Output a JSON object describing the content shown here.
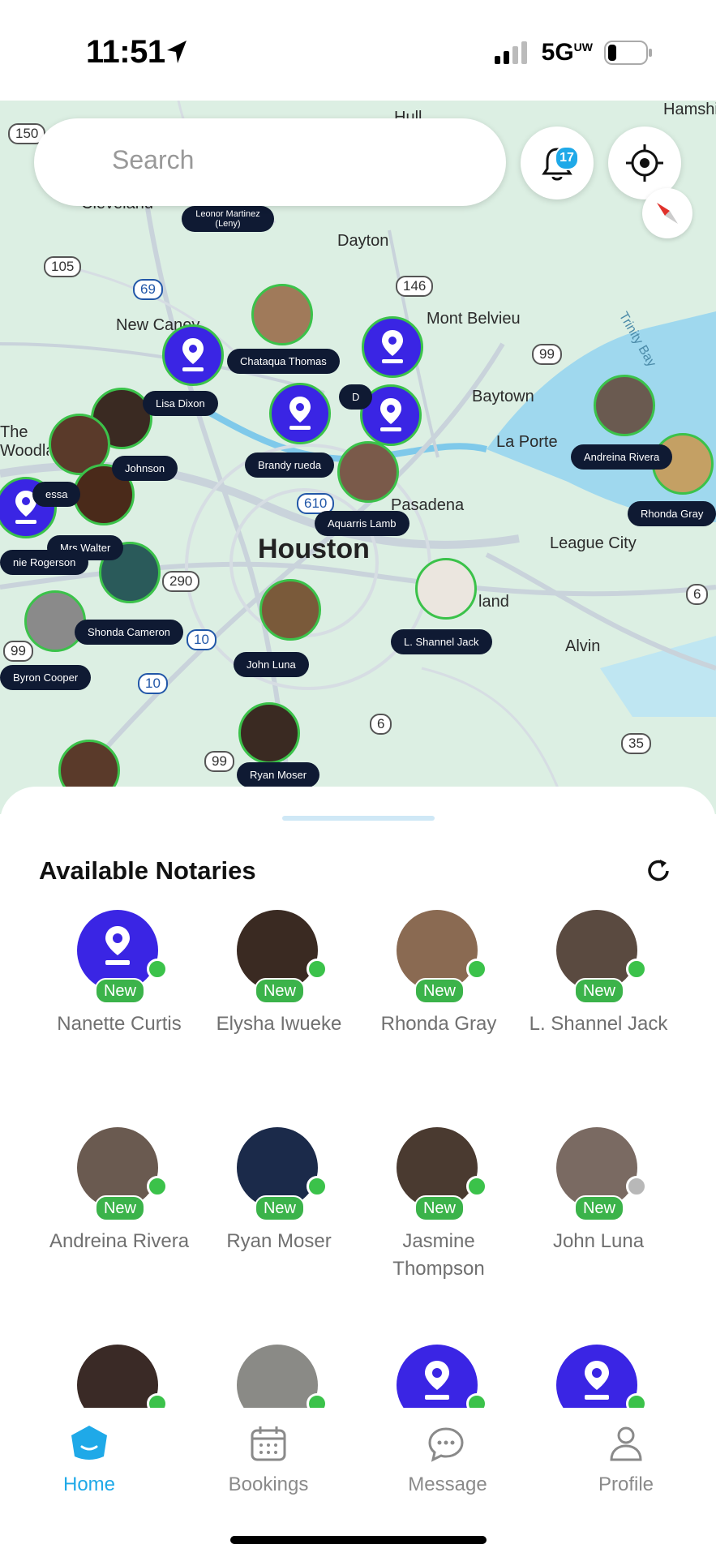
{
  "status_bar": {
    "time": "11:51",
    "network": "5G",
    "network_sup": "UW"
  },
  "search": {
    "placeholder": "Search"
  },
  "notifications": {
    "count": "17"
  },
  "map": {
    "places": [
      {
        "name": "Dayton"
      },
      {
        "name": "New Caney"
      },
      {
        "name": "Mont Belvieu"
      },
      {
        "name": "Baytown"
      },
      {
        "name": "La Porte"
      },
      {
        "name": "Pasadena"
      },
      {
        "name": "Houston"
      },
      {
        "name": "League City"
      },
      {
        "name": "Alvin"
      },
      {
        "name": "The Woodlands"
      },
      {
        "name": "Cleveland"
      },
      {
        "name": "Trinity Bay"
      },
      {
        "name": "land"
      },
      {
        "name": "Hull"
      },
      {
        "name": "Hamshire"
      }
    ],
    "highways": [
      "150",
      "105",
      "69",
      "146",
      "99",
      "290",
      "10",
      "610",
      "99",
      "10",
      "6",
      "99",
      "35",
      "6"
    ],
    "pins": [
      {
        "label": "Leonor Martinez (Leny)"
      },
      {
        "label": "Chataqua Thomas"
      },
      {
        "label": "Lisa Dixon"
      },
      {
        "label": "D"
      },
      {
        "label": "Brandy rueda"
      },
      {
        "label": "Johnson"
      },
      {
        "label": "Aquarris Lamb"
      },
      {
        "label": "Andreina Rivera"
      },
      {
        "label": "Rhonda Gray"
      },
      {
        "label": "Mrs.Walter"
      },
      {
        "label": "nie Rogerson"
      },
      {
        "label": "essa"
      },
      {
        "label": "Shonda Cameron"
      },
      {
        "label": "Byron Cooper"
      },
      {
        "label": "John Luna"
      },
      {
        "label": "L. Shannel Jack"
      },
      {
        "label": "Ryan Moser"
      }
    ]
  },
  "sheet": {
    "title": "Available Notaries",
    "new_label": "New",
    "notaries": [
      {
        "name": "Nanette Curtis",
        "type": "pin",
        "online": true
      },
      {
        "name": "Elysha Iwueke",
        "type": "photo",
        "color": "#3a2a22",
        "online": true
      },
      {
        "name": "Rhonda Gray",
        "type": "photo",
        "color": "#8a6a52",
        "online": true
      },
      {
        "name": "L. Shannel Jack",
        "type": "photo",
        "color": "#5a4a40",
        "online": true
      },
      {
        "name": "Andreina Rivera",
        "type": "photo",
        "color": "#6a5a50",
        "online": true
      },
      {
        "name": "Ryan Moser",
        "type": "photo",
        "color": "#1b2a4a",
        "online": true
      },
      {
        "name": "Jasmine Thompson",
        "type": "photo",
        "color": "#4a3a30",
        "online": true
      },
      {
        "name": "John Luna",
        "type": "photo",
        "color": "#7a6a62",
        "online": false
      },
      {
        "name": "",
        "type": "photo",
        "color": "#3a2a26",
        "online": true
      },
      {
        "name": "",
        "type": "photo",
        "color": "#8a8a86",
        "online": true
      },
      {
        "name": "",
        "type": "pin",
        "online": true
      },
      {
        "name": "",
        "type": "pin",
        "online": true
      }
    ]
  },
  "tabs": [
    {
      "label": "Home",
      "icon": "home-icon",
      "active": true
    },
    {
      "label": "Bookings",
      "icon": "calendar-icon",
      "active": false
    },
    {
      "label": "Message",
      "icon": "message-icon",
      "active": false
    },
    {
      "label": "Profile",
      "icon": "profile-icon",
      "active": false
    }
  ],
  "colors": {
    "accent": "#1fa9e8",
    "pin": "#3a25e4",
    "online": "#3bc24a",
    "label_bg": "#0f1a33"
  }
}
